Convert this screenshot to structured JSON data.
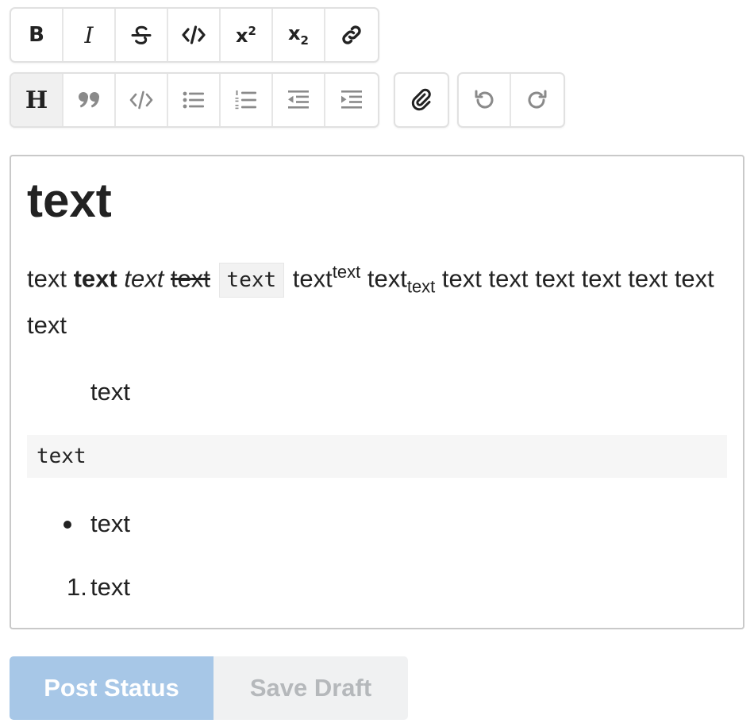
{
  "toolbar": {
    "row1": [
      {
        "name": "bold-button",
        "icon": "bold-icon",
        "glyph": "B"
      },
      {
        "name": "italic-button",
        "icon": "italic-icon",
        "glyph": "I"
      },
      {
        "name": "strikethrough-button",
        "icon": "strikethrough-icon"
      },
      {
        "name": "code-button",
        "icon": "code-icon"
      },
      {
        "name": "superscript-button",
        "icon": "superscript-icon",
        "glyph": "x",
        "mark": "2"
      },
      {
        "name": "subscript-button",
        "icon": "subscript-icon",
        "glyph": "x",
        "mark": "2"
      },
      {
        "name": "link-button",
        "icon": "link-icon"
      }
    ],
    "row2": [
      {
        "name": "heading-button",
        "icon": "heading-icon",
        "glyph": "H",
        "active": true
      },
      {
        "name": "quote-button",
        "icon": "quote-icon"
      },
      {
        "name": "code-block-button",
        "icon": "code-block-icon"
      },
      {
        "name": "bullet-list-button",
        "icon": "bullet-list-icon"
      },
      {
        "name": "numbered-list-button",
        "icon": "numbered-list-icon"
      },
      {
        "name": "decrease-indent-button",
        "icon": "outdent-icon"
      },
      {
        "name": "increase-indent-button",
        "icon": "indent-icon"
      }
    ],
    "attach": {
      "name": "attach-button",
      "icon": "paperclip-icon"
    },
    "history": [
      {
        "name": "undo-button",
        "icon": "undo-icon"
      },
      {
        "name": "redo-button",
        "icon": "redo-icon"
      }
    ]
  },
  "editor": {
    "heading": "text",
    "paragraph": {
      "plain1": "text",
      "bold": "text",
      "italic": "text",
      "strike": "text",
      "code": "text",
      "sup_base": "text",
      "sup": "text",
      "sub_base": "text",
      "sub": "text",
      "rest": "text text text text text text text"
    },
    "quote": "text",
    "code_block": "text",
    "bullet_item": "text",
    "ordered_number": "1.",
    "ordered_item": "text"
  },
  "actions": {
    "post_label": "Post Status",
    "draft_label": "Save Draft",
    "post_color": "#a7c7e7",
    "draft_color": "#f0f1f2"
  }
}
